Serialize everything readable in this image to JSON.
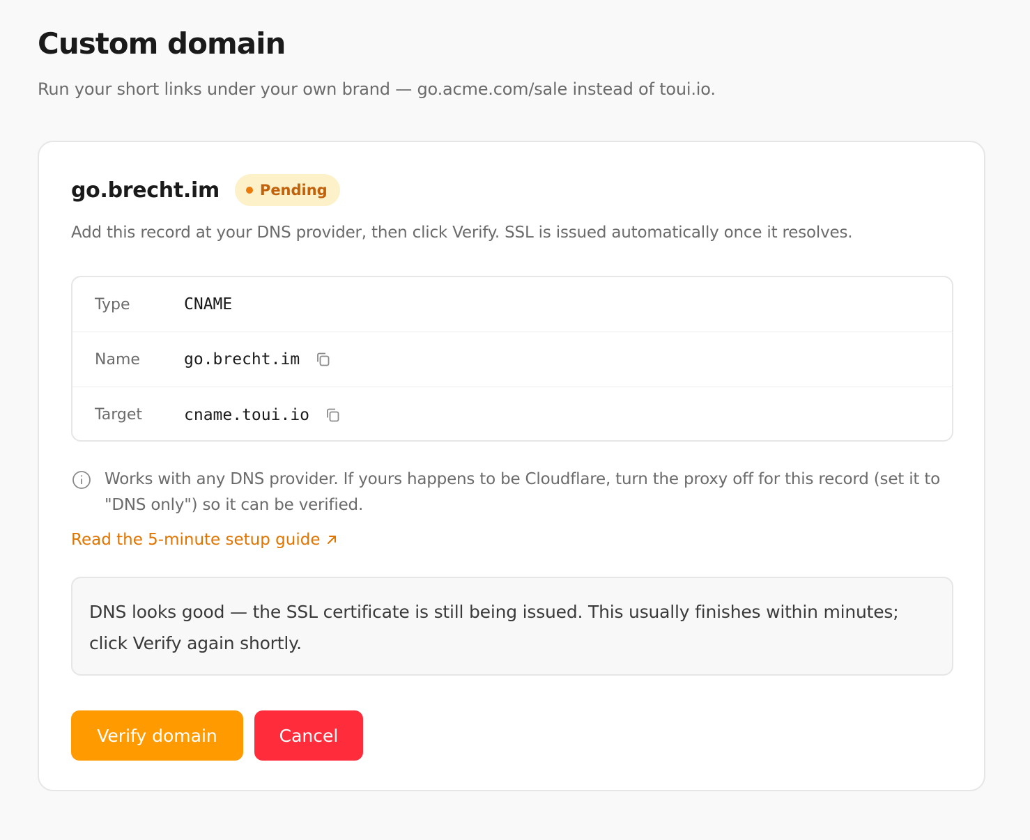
{
  "header": {
    "title": "Custom domain",
    "subtitle": "Run your short links under your own brand — go.acme.com/sale instead of toui.io."
  },
  "domain": {
    "name": "go.brecht.im",
    "status": "Pending",
    "status_color": "#ea7a0c",
    "instruction": "Add this record at your DNS provider, then click Verify. SSL is issued automatically once it resolves."
  },
  "dns_record": {
    "rows": [
      {
        "label": "Type",
        "value": "CNAME",
        "copyable": false
      },
      {
        "label": "Name",
        "value": "go.brecht.im",
        "copyable": true,
        "icon": "copy-icon"
      },
      {
        "label": "Target",
        "value": "cname.toui.io",
        "copyable": true,
        "icon": "copy-icon"
      }
    ]
  },
  "note": {
    "icon": "info-icon",
    "text": "Works with any DNS provider. If yours happens to be Cloudflare, turn the proxy off for this record (set it to \"DNS only\") so it can be verified."
  },
  "guide_link": {
    "label": "Read the 5-minute setup guide",
    "icon": "external-arrow-icon",
    "color": "#e07400"
  },
  "status_message": "DNS looks good — the SSL certificate is still being issued. This usually finishes within minutes; click Verify again shortly.",
  "actions": {
    "verify_label": "Verify domain",
    "verify_color": "#ff9a00",
    "cancel_label": "Cancel",
    "cancel_color": "#ff2d3c"
  }
}
